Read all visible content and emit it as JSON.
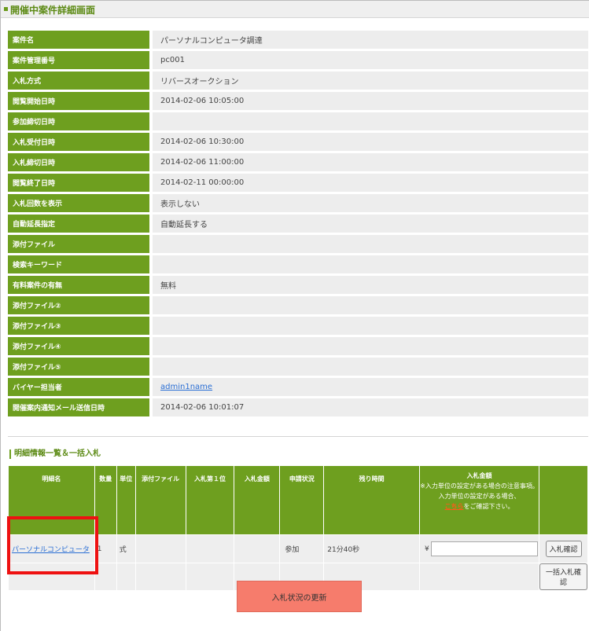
{
  "page": {
    "title": "開催中案件詳細画面"
  },
  "details": [
    {
      "label": "案件名",
      "value": "パーソナルコンピュータ調達"
    },
    {
      "label": "案件管理番号",
      "value": "pc001"
    },
    {
      "label": "入札方式",
      "value": "リバースオークション"
    },
    {
      "label": "閲覧開始日時",
      "value": "2014-02-06 10:05:00"
    },
    {
      "label": "参加締切日時",
      "value": ""
    },
    {
      "label": "入札受付日時",
      "value": "2014-02-06 10:30:00"
    },
    {
      "label": "入札締切日時",
      "value": "2014-02-06 11:00:00"
    },
    {
      "label": "閲覧終了日時",
      "value": "2014-02-11 00:00:00"
    },
    {
      "label": "入札回数を表示",
      "value": "表示しない"
    },
    {
      "label": "自動延長指定",
      "value": "自動延長する"
    },
    {
      "label": "添付ファイル",
      "value": ""
    },
    {
      "label": "検索キーワード",
      "value": ""
    },
    {
      "label": "有料案件の有無",
      "value": "無料"
    },
    {
      "label": "添付ファイル②",
      "value": ""
    },
    {
      "label": "添付ファイル③",
      "value": ""
    },
    {
      "label": "添付ファイル④",
      "value": ""
    },
    {
      "label": "添付ファイル⑤",
      "value": ""
    },
    {
      "label": "バイヤー担当者",
      "value": "admin1name",
      "link": true
    },
    {
      "label": "開催案内通知メール送信日時",
      "value": "2014-02-06 10:01:07"
    }
  ],
  "items_section": {
    "title": "明細情報一覧＆一括入札",
    "headers": {
      "name": "明細名",
      "qty": "数量",
      "unit": "単位",
      "attach": "添付ファイル",
      "first": "入札第１位",
      "amount": "入札金額",
      "status": "申請状況",
      "remaining": "残り時間",
      "bid_head": "入札金額",
      "bid_note1": "※入力単位の設定がある場合の注意事項。",
      "bid_note2": "入力単位の設定がある場合、",
      "bid_link": "こちら",
      "bid_note3": "をご確認下さい。"
    },
    "row": {
      "name": "パーソナルコンピュータ",
      "qty": "1",
      "unit": "式",
      "attach": "",
      "first": "",
      "amount": "",
      "status": "参加",
      "remaining": "21分40秒",
      "yen": "¥",
      "bid_value": "",
      "confirm_button": "入札確認"
    },
    "bulk_button": "一括入札確認"
  },
  "refresh_button": "入札状況の更新"
}
